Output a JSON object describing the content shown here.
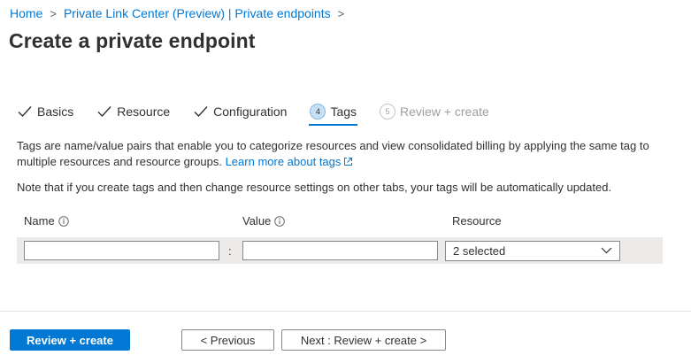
{
  "breadcrumb": {
    "items": [
      "Home",
      "Private Link Center (Preview) | Private endpoints"
    ],
    "separator": ">"
  },
  "page": {
    "title": "Create a private endpoint"
  },
  "tabs": [
    {
      "label": "Basics",
      "state": "done"
    },
    {
      "label": "Resource",
      "state": "done"
    },
    {
      "label": "Configuration",
      "state": "done"
    },
    {
      "label": "Tags",
      "number": "4",
      "state": "active"
    },
    {
      "label": "Review + create",
      "number": "5",
      "state": "disabled"
    }
  ],
  "content": {
    "description": "Tags are name/value pairs that enable you to categorize resources and view consolidated billing by applying the same tag to multiple resources and resource groups.",
    "learn_more": "Learn more about tags",
    "note": "Note that if you create tags and then change resource settings on other tabs, your tags will be automatically updated."
  },
  "table": {
    "headers": {
      "name": "Name",
      "value": "Value",
      "resource": "Resource"
    },
    "row": {
      "name": "",
      "separator": ":",
      "value": "",
      "resource": "2 selected"
    }
  },
  "footer": {
    "review_create": "Review + create",
    "previous": "< Previous",
    "next": "Next : Review + create >"
  },
  "colors": {
    "accent": "#0078d4",
    "text": "#323130",
    "disabled": "#a19f9d",
    "row_bg": "#edebe9"
  }
}
